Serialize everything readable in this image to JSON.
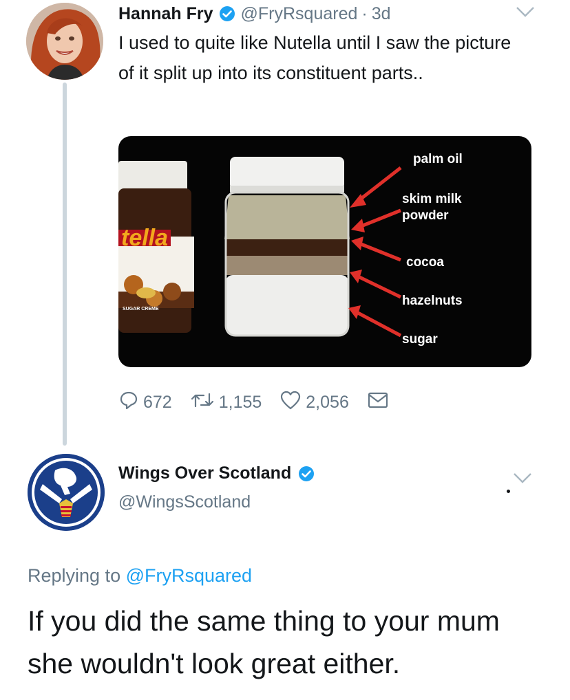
{
  "tweet": {
    "author_name": "Hannah Fry",
    "handle": "@FryRsquared",
    "separator": "·",
    "time": "3d",
    "text": "I used to quite like Nutella until I saw the picture of it split up into its constituent parts..",
    "verified": true,
    "media": {
      "jar_brand_text": "tella",
      "jar_small_text": "SUGAR CREME",
      "labels": [
        "palm oil",
        "skim milk powder",
        "cocoa",
        "hazelnuts",
        "sugar"
      ]
    },
    "actions": {
      "replies": "672",
      "retweets": "1,155",
      "likes": "2,056"
    },
    "icons": [
      "verified-badge-icon",
      "chevron-down-icon",
      "reply-icon",
      "retweet-icon",
      "heart-icon",
      "message-icon"
    ]
  },
  "reply": {
    "author_name": "Wings Over Scotland",
    "handle": "@WingsScotland",
    "verified": true,
    "replying_prefix": "Replying to",
    "replying_to": "@FryRsquared",
    "text": "If you did the same thing to your mum she wouldn't look great either."
  },
  "colors": {
    "accent": "#1da1f2",
    "secondary_text": "#657786",
    "arrow": "#e0302a"
  }
}
